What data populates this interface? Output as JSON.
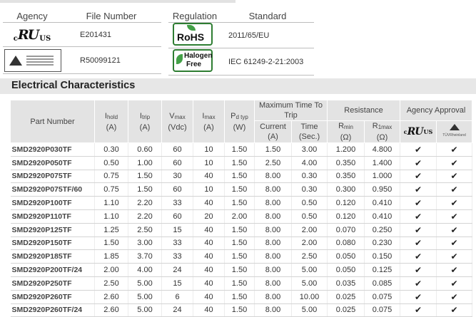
{
  "agency_table": {
    "headers": [
      "Agency",
      "File Number"
    ],
    "rows": [
      {
        "logo": "ul-recognized-logo",
        "logo_text": [
          "c",
          "RU",
          "US"
        ],
        "file_number": "E201431"
      },
      {
        "logo": "tuv-rheinland-logo",
        "file_number": "R50099121"
      }
    ]
  },
  "regulation_table": {
    "headers": [
      "Regulation",
      "Standard"
    ],
    "rows": [
      {
        "logo": "rohs-logo",
        "logo_text": "RoHS",
        "standard": "2011/65/EU"
      },
      {
        "logo": "halogen-free-logo",
        "logo_text": [
          "Halogen",
          "Free"
        ],
        "standard": "IEC 61249-2-21:2003"
      }
    ]
  },
  "section_title": "Electrical Characteristics",
  "columns": {
    "part_number": "Part Number",
    "ihold": {
      "main": "I",
      "sub": "hold",
      "unit": "(A)"
    },
    "itrip": {
      "main": "I",
      "sub": "trip",
      "unit": "(A)"
    },
    "vmax": {
      "main": "V",
      "sub": "max",
      "unit": "(Vdc)"
    },
    "imax": {
      "main": "I",
      "sub": "max",
      "unit": "(A)"
    },
    "pdtyp": {
      "main": "P",
      "sub": "d typ",
      "unit": "(W)"
    },
    "max_time_to_trip": "Maximum Time To Trip",
    "current": {
      "main": "Current",
      "unit": "(A)"
    },
    "time": {
      "main": "Time",
      "unit": "(Sec.)"
    },
    "resistance": "Resistance",
    "rmin": {
      "main": "R",
      "sub": "min",
      "unit": "(Ω)"
    },
    "r1max": {
      "main": "R",
      "sub": "1max",
      "unit": "(Ω)"
    },
    "agency_approval": "Agency Approval",
    "check_symbol": "✔",
    "tuv_caption": "TÜVRheinland"
  },
  "rows": [
    [
      "SMD2920P030TF",
      "0.30",
      "0.60",
      "60",
      "10",
      "1.50",
      "1.50",
      "3.00",
      "1.200",
      "4.800"
    ],
    [
      "SMD2920P050TF",
      "0.50",
      "1.00",
      "60",
      "10",
      "1.50",
      "2.50",
      "4.00",
      "0.350",
      "1.400"
    ],
    [
      "SMD2920P075TF",
      "0.75",
      "1.50",
      "30",
      "40",
      "1.50",
      "8.00",
      "0.30",
      "0.350",
      "1.000"
    ],
    [
      "SMD2920P075TF/60",
      "0.75",
      "1.50",
      "60",
      "10",
      "1.50",
      "8.00",
      "0.30",
      "0.300",
      "0.950"
    ],
    [
      "SMD2920P100TF",
      "1.10",
      "2.20",
      "33",
      "40",
      "1.50",
      "8.00",
      "0.50",
      "0.120",
      "0.410"
    ],
    [
      "SMD2920P110TF",
      "1.10",
      "2.20",
      "60",
      "20",
      "2.00",
      "8.00",
      "0.50",
      "0.120",
      "0.410"
    ],
    [
      "SMD2920P125TF",
      "1.25",
      "2.50",
      "15",
      "40",
      "1.50",
      "8.00",
      "2.00",
      "0.070",
      "0.250"
    ],
    [
      "SMD2920P150TF",
      "1.50",
      "3.00",
      "33",
      "40",
      "1.50",
      "8.00",
      "2.00",
      "0.080",
      "0.230"
    ],
    [
      "SMD2920P185TF",
      "1.85",
      "3.70",
      "33",
      "40",
      "1.50",
      "8.00",
      "2.50",
      "0.050",
      "0.150"
    ],
    [
      "SMD2920P200TF/24",
      "2.00",
      "4.00",
      "24",
      "40",
      "1.50",
      "8.00",
      "5.00",
      "0.050",
      "0.125"
    ],
    [
      "SMD2920P250TF",
      "2.50",
      "5.00",
      "15",
      "40",
      "1.50",
      "8.00",
      "5.00",
      "0.035",
      "0.085"
    ],
    [
      "SMD2920P260TF",
      "2.60",
      "5.00",
      "6",
      "40",
      "1.50",
      "8.00",
      "10.00",
      "0.025",
      "0.075"
    ],
    [
      "SMD2920P260TF/24",
      "2.60",
      "5.00",
      "24",
      "40",
      "1.50",
      "8.00",
      "5.00",
      "0.025",
      "0.075"
    ]
  ]
}
